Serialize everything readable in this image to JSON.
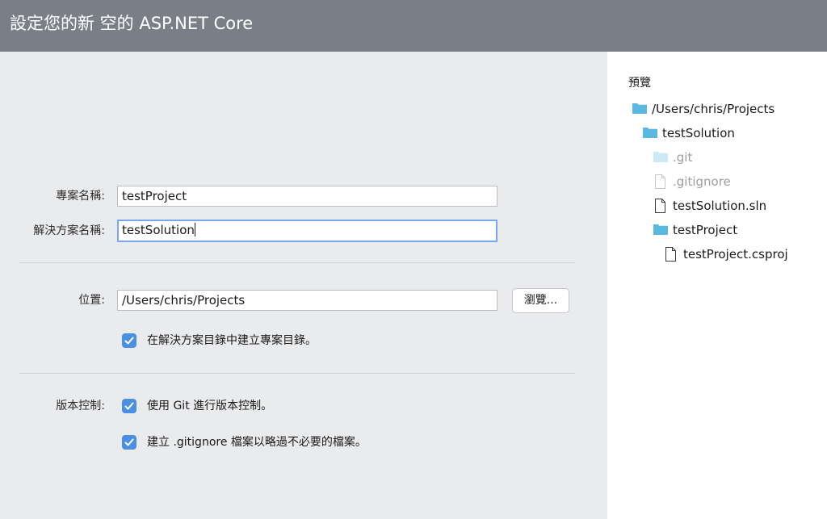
{
  "header": {
    "title": "設定您的新 空的 ASP.NET Core"
  },
  "form": {
    "project_name_label": "專案名稱:",
    "project_name_value": "testProject",
    "solution_name_label": "解決方案名稱:",
    "solution_name_value": "testSolution",
    "location_label": "位置:",
    "location_value": "/Users/chris/Projects",
    "browse_label": "瀏覽...",
    "create_project_dir_label": "在解決方案目錄中建立專案目錄。",
    "create_project_dir_checked": true,
    "version_control_label": "版本控制:",
    "use_git_label": "使用 Git 進行版本控制。",
    "use_git_checked": true,
    "create_gitignore_label": "建立 .gitignore 檔案以略過不必要的檔案。",
    "create_gitignore_checked": true
  },
  "preview": {
    "title": "預覽",
    "tree": [
      {
        "name": "/Users/chris/Projects",
        "type": "folder",
        "depth": 0,
        "dimmed": false
      },
      {
        "name": "testSolution",
        "type": "folder",
        "depth": 1,
        "dimmed": false
      },
      {
        "name": ".git",
        "type": "folder",
        "depth": 2,
        "dimmed": true
      },
      {
        "name": ".gitignore",
        "type": "file",
        "depth": 2,
        "dimmed": true
      },
      {
        "name": "testSolution.sln",
        "type": "file",
        "depth": 2,
        "dimmed": false
      },
      {
        "name": "testProject",
        "type": "folder",
        "depth": 2,
        "dimmed": false
      },
      {
        "name": "testProject.csproj",
        "type": "file",
        "depth": 3,
        "dimmed": false
      }
    ]
  },
  "colors": {
    "header_bg": "#7a7f87",
    "form_bg": "#eaebed",
    "checkbox_accent": "#4a90e2",
    "folder_icon": "#5bb8e0",
    "folder_icon_dim": "#cde9f5"
  }
}
